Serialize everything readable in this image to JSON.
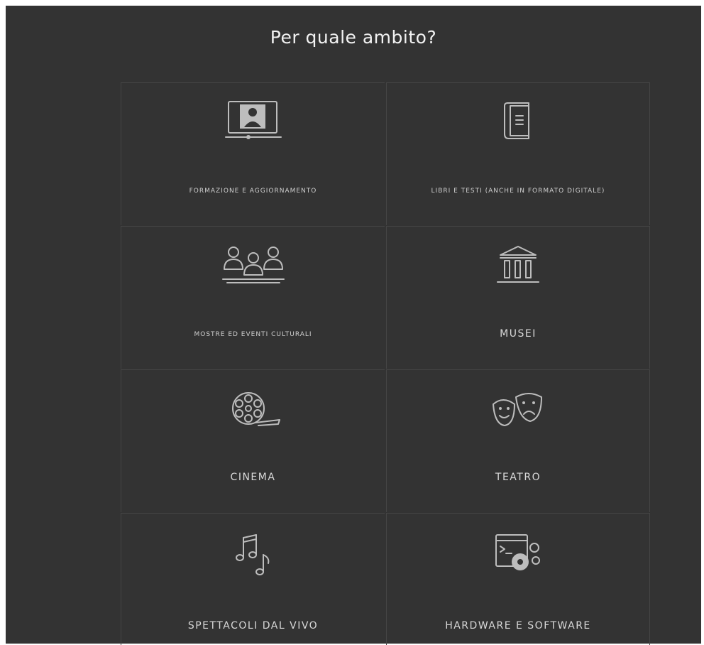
{
  "title": "Per quale ambito?",
  "colors": {
    "background": "#333333",
    "grid_line": "#454545",
    "icon": "#bdbdbd",
    "text": "#d9d9d9"
  },
  "tiles": [
    {
      "label": "FORMAZIONE E AGGIORNAMENTO",
      "icon": "video-lesson-icon"
    },
    {
      "label": "LIBRI E TESTI (ANCHE IN FORMATO DIGITALE)",
      "icon": "book-icon"
    },
    {
      "label": "MOSTRE ED EVENTI CULTURALI",
      "icon": "audience-icon"
    },
    {
      "label": "MUSEI",
      "icon": "museum-icon"
    },
    {
      "label": "CINEMA",
      "icon": "film-reel-icon"
    },
    {
      "label": "TEATRO",
      "icon": "theatre-masks-icon"
    },
    {
      "label": "SPETTACOLI DAL VIVO",
      "icon": "music-notes-icon"
    },
    {
      "label": "HARDWARE E SOFTWARE",
      "icon": "software-gears-icon"
    }
  ]
}
